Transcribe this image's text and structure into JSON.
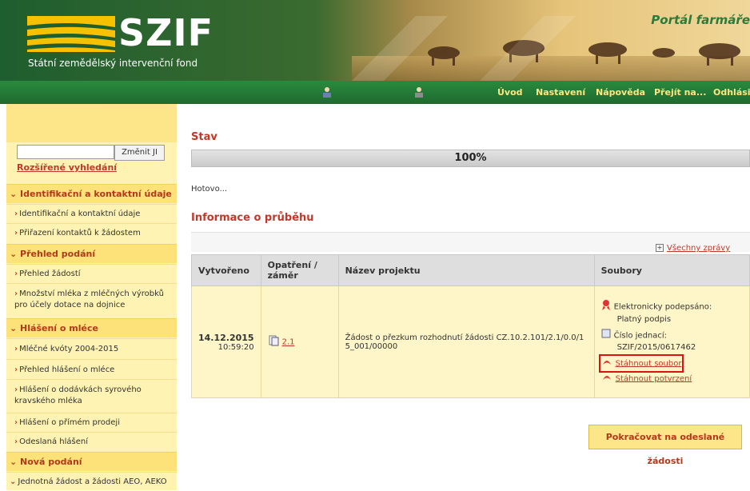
{
  "header": {
    "logo": "SZIF",
    "subtitle": "Státní zemědělský intervenční fond",
    "portal_title": "Portál farmáře"
  },
  "nav": {
    "items": [
      "Úvod",
      "Nastavení",
      "Nápověda",
      "Přejít na...",
      "Odhlásit"
    ]
  },
  "sidebar": {
    "search_button": "Změnit JI",
    "advanced_search": "Rozšířené vyhledání",
    "sections": [
      {
        "title": "Identifikační a kontaktní údaje",
        "items": [
          "Identifikační a kontaktní údaje",
          "Přiřazení kontaktů k žádostem"
        ]
      },
      {
        "title": "Přehled podání",
        "items": [
          "Přehled žádostí",
          "Množství mléka z mléčných výrobků pro účely dotace na dojnice"
        ]
      },
      {
        "title": "Hlášení o mléce",
        "items": [
          "Mléčné kvóty 2004-2015",
          "Přehled hlášení o mléce",
          "Hlášení o dodávkách syrového kravského mléka",
          "Hlášení o přímém prodeji",
          "Odeslaná hlášení"
        ]
      },
      {
        "title": "Nová podání",
        "items": [
          "Jednotná žádost a žádosti AEO, AEKO"
        ]
      }
    ]
  },
  "main": {
    "status_heading": "Stav",
    "progress": 100,
    "progress_text": "100%",
    "done_text": "Hotovo...",
    "info_heading": "Informace o průběhu",
    "all_reports": "Všechny zprávy",
    "table": {
      "headers": [
        "Vytvořeno",
        "Opatření / záměr",
        "Název projektu",
        "Soubory"
      ],
      "row": {
        "date": "14.12.2015",
        "time": "10:59:20",
        "measure": "2.1",
        "project": "Žádost o přezkum rozhodnutí žádosti CZ.10.2.101/2.1/0.0/15_001/00000",
        "signed_line1": "Elektronicky podepsáno:",
        "signed_line2": "Platný podpis",
        "ref_line1": "Číslo jednací:",
        "ref_line2": "SZIF/2015/0617462",
        "download_file": "Stáhnout soubor",
        "download_confirm": "Stáhnout potvrzení"
      }
    },
    "continue_button": "Pokračovat na odeslané žádosti"
  },
  "colors": {
    "accent_red": "#c0392b",
    "nav_green": "#2a8a3e",
    "sidebar_yellow": "#fef3b3"
  }
}
